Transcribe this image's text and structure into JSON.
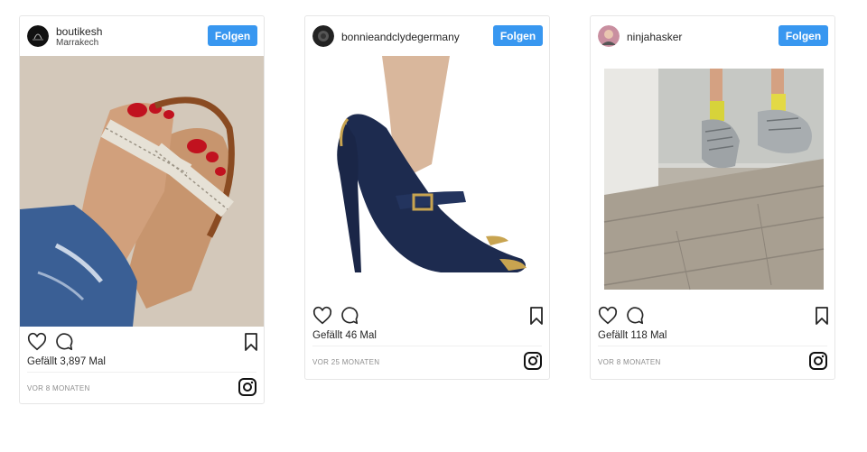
{
  "posts": [
    {
      "username": "boutikesh",
      "location": "Marrakech",
      "follow_label": "Folgen",
      "likes": "Gefällt 3,897 Mal",
      "time": "VOR 8 MONATEN"
    },
    {
      "username": "bonnieandclydegermany",
      "follow_label": "Folgen",
      "likes": "Gefällt 46 Mal",
      "time": "VOR 25 MONATEN"
    },
    {
      "username": "ninjahasker",
      "follow_label": "Folgen",
      "likes": "Gefällt 118 Mal",
      "time": "VOR 8 MONATEN"
    }
  ],
  "colors": {
    "follow_button": "#3897f0",
    "border": "#e6e6e6",
    "muted_text": "#8e8e8e"
  },
  "icons": [
    "heart-icon",
    "comment-icon",
    "bookmark-icon",
    "instagram-icon"
  ]
}
